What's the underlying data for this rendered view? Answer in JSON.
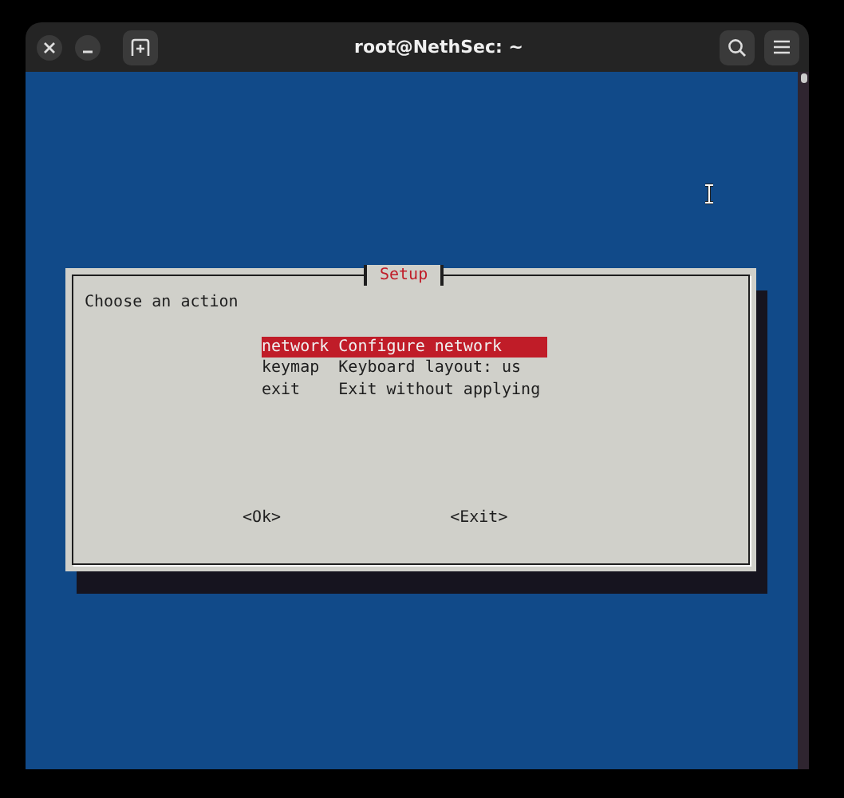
{
  "window": {
    "title": "root@NethSec: ~"
  },
  "dialog": {
    "title": "Setup",
    "prompt": "Choose an action",
    "menu": [
      {
        "tag": "network",
        "description": "Configure network",
        "selected": true
      },
      {
        "tag": "keymap",
        "description": "Keyboard layout: us",
        "selected": false
      },
      {
        "tag": "exit",
        "description": "Exit without applying",
        "selected": false
      }
    ],
    "buttons": [
      {
        "label": "<Ok>",
        "selected": false
      },
      {
        "label": "<Exit>",
        "selected": false
      }
    ]
  }
}
